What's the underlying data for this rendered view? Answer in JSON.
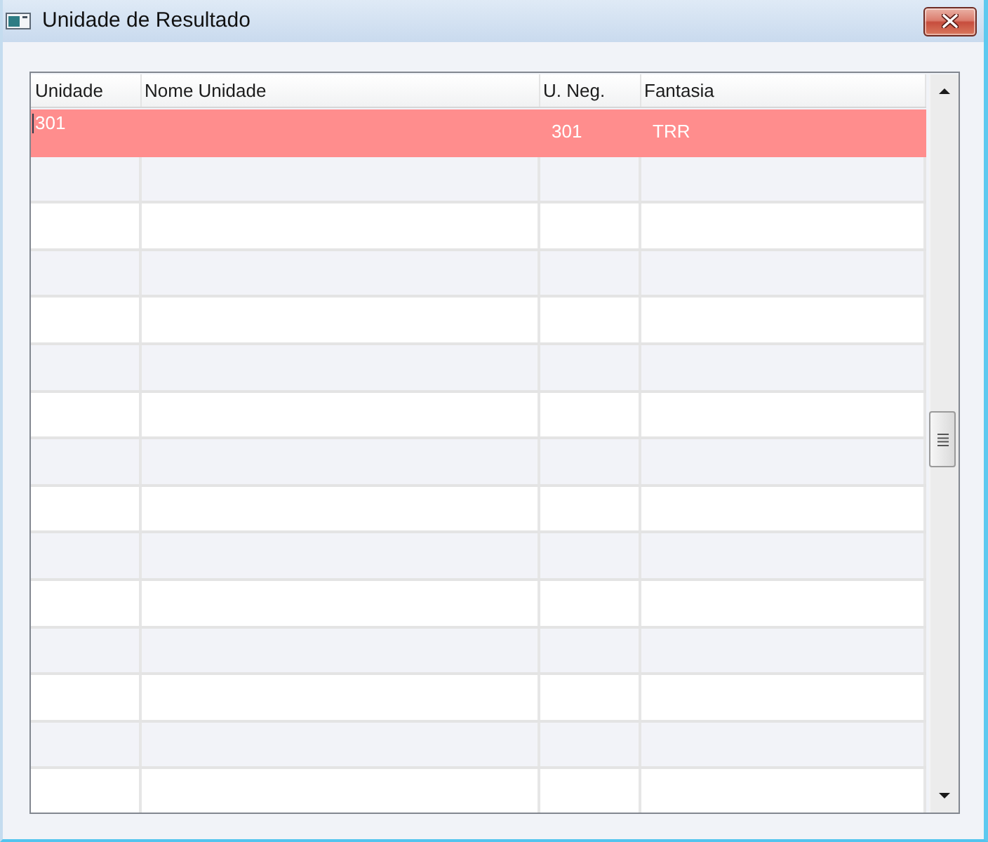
{
  "window": {
    "title": "Unidade de Resultado"
  },
  "table": {
    "columns": [
      "Unidade",
      "Nome Unidade",
      "U. Neg.",
      "Fantasia"
    ],
    "rows": [
      {
        "selected": true,
        "editing": true,
        "unidade": "301",
        "u_neg": "301",
        "fantasia": "TRR"
      },
      {
        "selected": false,
        "editing": false
      },
      {
        "selected": false,
        "editing": false
      },
      {
        "selected": false,
        "editing": false
      },
      {
        "selected": false,
        "editing": false
      },
      {
        "selected": false,
        "editing": false
      },
      {
        "selected": false,
        "editing": false
      },
      {
        "selected": false,
        "editing": false
      },
      {
        "selected": false,
        "editing": false
      },
      {
        "selected": false,
        "editing": false
      },
      {
        "selected": false,
        "editing": false
      },
      {
        "selected": false,
        "editing": false
      },
      {
        "selected": false,
        "editing": false
      },
      {
        "selected": false,
        "editing": false
      },
      {
        "selected": false,
        "editing": false
      }
    ]
  }
}
